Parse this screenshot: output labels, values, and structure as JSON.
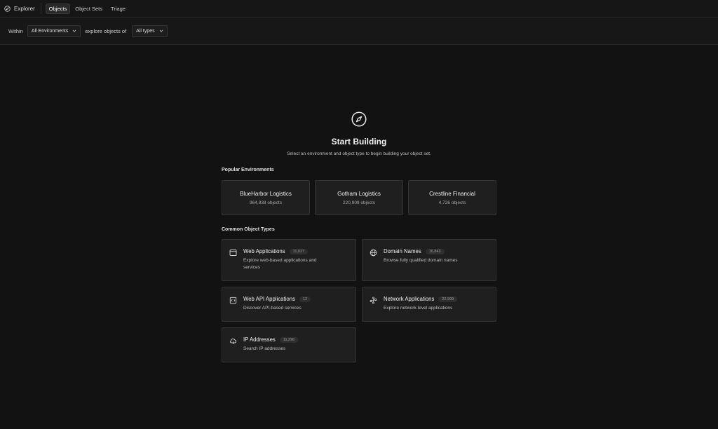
{
  "topbar": {
    "app_name": "Explorer",
    "tabs": [
      {
        "label": "Objects",
        "active": true
      },
      {
        "label": "Object Sets",
        "active": false
      },
      {
        "label": "Triage",
        "active": false
      }
    ]
  },
  "filters": {
    "within_label": "Within",
    "environment_value": "All Environments",
    "explore_label": "explore objects of",
    "type_value": "All types"
  },
  "hero": {
    "icon": "compass-icon",
    "title": "Start Building",
    "subtitle": "Select an environment and object type to begin building your object set."
  },
  "environments": {
    "label": "Popular Environments",
    "items": [
      {
        "name": "BlueHarbor Logistics",
        "count": "964,838 objects"
      },
      {
        "name": "Gotham Logistics",
        "count": "220,909 objects"
      },
      {
        "name": "Crestline Financial",
        "count": "4,726 objects"
      }
    ]
  },
  "object_types": {
    "label": "Common Object Types",
    "items": [
      {
        "name": "Web Applications",
        "badge": "11,027",
        "description": "Explore web-based applications and services",
        "icon": "browser-window-icon"
      },
      {
        "name": "Domain Names",
        "badge": "16,843",
        "description": "Browse fully qualified domain names",
        "icon": "globe-icon"
      },
      {
        "name": "Web API Applications",
        "badge": "12",
        "description": "Discover API-based services",
        "icon": "api-icon"
      },
      {
        "name": "Network Applications",
        "badge": "22,999",
        "description": "Explore network-level applications",
        "icon": "network-icon"
      },
      {
        "name": "IP Addresses",
        "badge": "11,296",
        "description": "Search IP addresses",
        "icon": "cloud-icon"
      }
    ]
  }
}
